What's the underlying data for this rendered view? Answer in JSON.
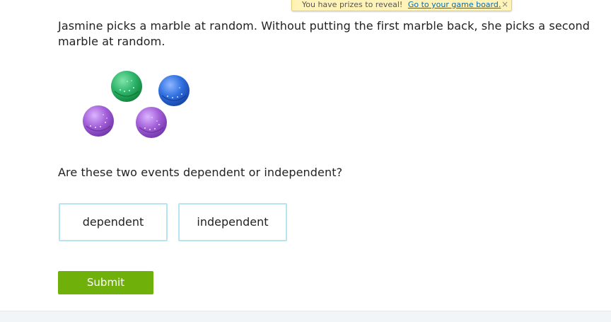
{
  "banner": {
    "text": "You have prizes to reveal!",
    "link": "Go to your game board.",
    "close": "×"
  },
  "question": {
    "text": "Jasmine picks a marble at random. Without putting the first marble back, she picks a second marble at random.",
    "prompt": "Are these two events dependent or independent?"
  },
  "marbles": [
    {
      "color": "green",
      "hex": "#2db56a"
    },
    {
      "color": "blue",
      "hex": "#2f6fe0"
    },
    {
      "color": "purple",
      "hex": "#a25ed8"
    },
    {
      "color": "purple",
      "hex": "#a25ed8"
    }
  ],
  "choices": {
    "dependent": "dependent",
    "independent": "independent"
  },
  "submit": {
    "label": "Submit"
  },
  "colors": {
    "submit_bg": "#6fb10a",
    "choice_border": "#b7e4f0",
    "banner_bg": "#fff3b8"
  }
}
